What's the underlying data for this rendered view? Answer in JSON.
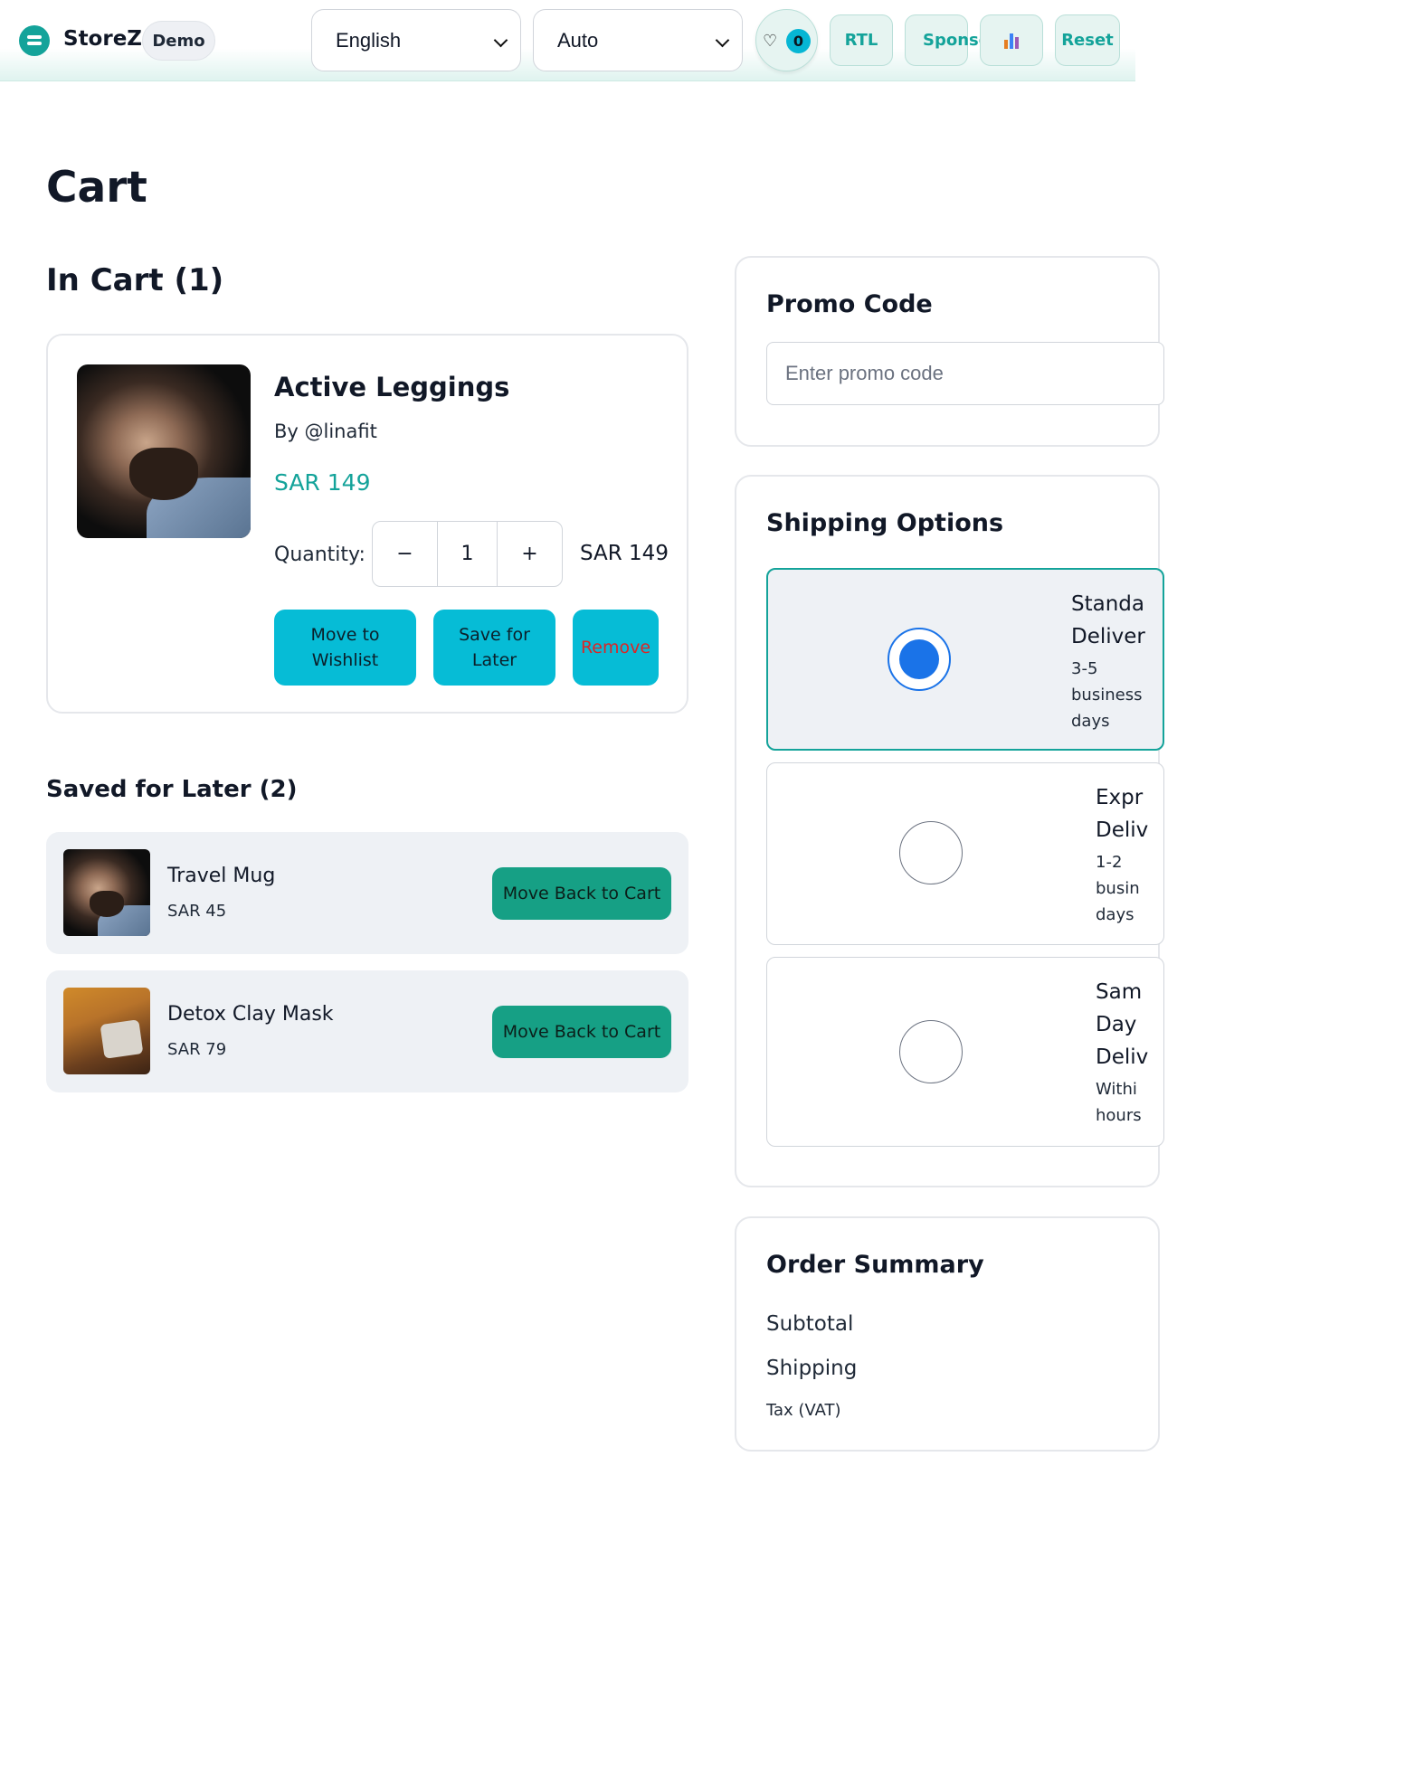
{
  "header": {
    "brand": "StoreZ",
    "demo_label": "Demo",
    "language": "English",
    "theme": "Auto",
    "wishlist_count": "0",
    "rtl_label": "RTL",
    "sponsor_label": "Sponsor",
    "reset_label": "Reset",
    "accent_color": "#14a39a"
  },
  "page": {
    "title": "Cart",
    "in_cart_heading": "In Cart (1)"
  },
  "cart_item": {
    "name": "Active Leggings",
    "by": "By @linafit",
    "price": "SAR 149",
    "quantity_label": "Quantity:",
    "minus": "−",
    "quantity": "1",
    "plus": "+",
    "line_total": "SAR 149",
    "move_to_wishlist": [
      "Move to",
      "Wishlist"
    ],
    "save_for_later": [
      "Save for",
      "Later"
    ],
    "remove": "Remove"
  },
  "saved": {
    "heading": "Saved for Later (2)",
    "items": [
      {
        "name": "Travel Mug",
        "price": "SAR 45",
        "button": "Move Back to Cart"
      },
      {
        "name": "Detox Clay Mask",
        "price": "SAR 79",
        "button": "Move Back to Cart"
      }
    ]
  },
  "promo": {
    "heading": "Promo Code",
    "placeholder": "Enter promo code"
  },
  "shipping": {
    "heading": "Shipping Options",
    "options": [
      {
        "name_lines": [
          "Standa",
          "Deliver"
        ],
        "desc_lines": [
          "3-5",
          "business",
          "days"
        ],
        "selected": true
      },
      {
        "name_lines": [
          "Expr",
          "Deliv"
        ],
        "desc_lines": [
          "1-2",
          "busin",
          "days"
        ],
        "selected": false
      },
      {
        "name_lines": [
          "Sam",
          "Day",
          "Deliv"
        ],
        "desc_lines": [
          "Withi",
          "hours"
        ],
        "selected": false
      }
    ]
  },
  "summary": {
    "heading": "Order Summary",
    "subtotal_label": "Subtotal",
    "shipping_label": "Shipping",
    "tax_label": "Tax (VAT)"
  }
}
